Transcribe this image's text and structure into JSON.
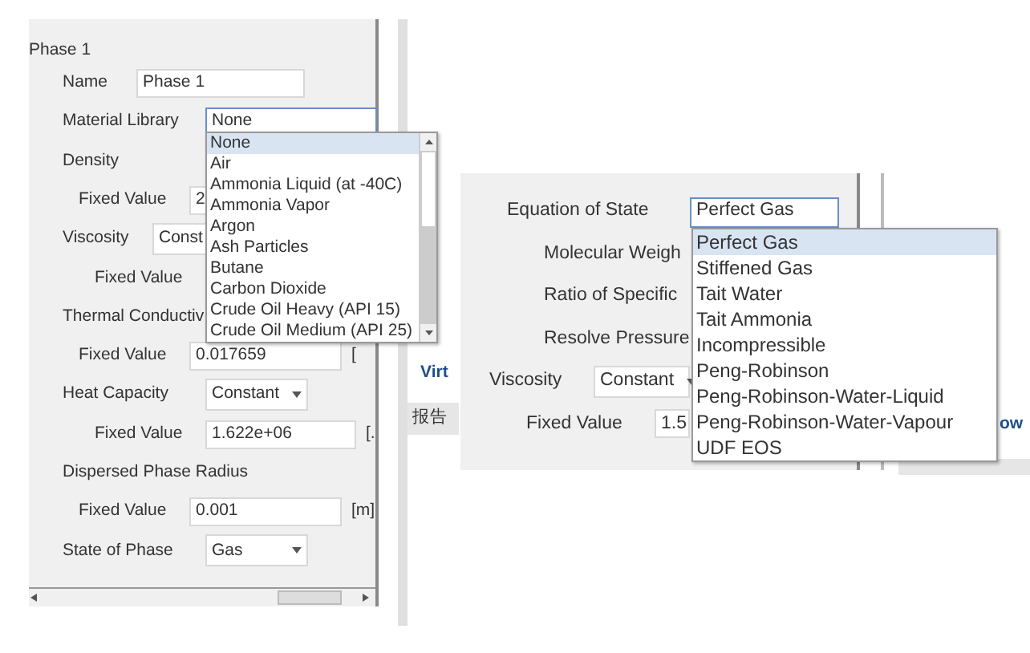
{
  "phase_panel": {
    "title": "Phase 1",
    "fields": [
      {
        "kind": "input",
        "label": "Name",
        "value": "Phase 1"
      },
      {
        "kind": "select-open",
        "label": "Material Library",
        "value": "None"
      },
      {
        "kind": "heading",
        "label": "Density",
        "children": [
          {
            "kind": "input",
            "label": "Fixed Value",
            "value": "2"
          }
        ]
      },
      {
        "kind": "select",
        "label": "Viscosity",
        "value": "Const",
        "children": [
          {
            "kind": "heading",
            "label": "Fixed Value"
          }
        ]
      },
      {
        "kind": "heading",
        "label": "Thermal Conductiv",
        "children": [
          {
            "kind": "input",
            "label": "Fixed Value",
            "value": "0.017659",
            "unit": "["
          }
        ]
      },
      {
        "kind": "select",
        "label": "Heat Capacity",
        "value": "Constant",
        "children": [
          {
            "kind": "input",
            "label": "Fixed Value",
            "value": "1.622e+06",
            "unit": "[."
          }
        ]
      },
      {
        "kind": "heading",
        "label": "Dispersed Phase Radius",
        "children": [
          {
            "kind": "input",
            "label": "Fixed Value",
            "value": "0.001",
            "unit": "[m]"
          }
        ]
      },
      {
        "kind": "select",
        "label": "State of Phase",
        "value": "Gas"
      }
    ],
    "material_options": [
      {
        "label": "None",
        "selected": true
      },
      {
        "label": "Air",
        "selected": false
      },
      {
        "label": "Ammonia Liquid (at -40C)",
        "selected": false
      },
      {
        "label": "Ammonia Vapor",
        "selected": false
      },
      {
        "label": "Argon",
        "selected": false
      },
      {
        "label": "Ash Particles",
        "selected": false
      },
      {
        "label": "Butane",
        "selected": false
      },
      {
        "label": "Carbon Dioxide",
        "selected": false
      },
      {
        "label": "Crude Oil Heavy (API 15)",
        "selected": false
      },
      {
        "label": "Crude Oil Medium (API 25)",
        "selected": false
      }
    ]
  },
  "background_window": {
    "link": "Virt",
    "tab": "报告",
    "right_link": "ow"
  },
  "eos_panel": {
    "fields": [
      {
        "kind": "select-open",
        "label": "Equation of State",
        "value": "Perfect Gas"
      },
      {
        "kind": "heading",
        "label": "Molecular Weigh"
      },
      {
        "kind": "heading",
        "label": "Ratio of Specific"
      },
      {
        "kind": "heading",
        "label": "Resolve Pressure"
      },
      {
        "kind": "select",
        "label": "Viscosity",
        "value": "Constant"
      },
      {
        "kind": "input",
        "label": "Fixed Value",
        "value": "1.5"
      }
    ],
    "eos_options": [
      {
        "label": "Perfect Gas",
        "selected": true
      },
      {
        "label": "Stiffened Gas",
        "selected": false
      },
      {
        "label": "Tait Water",
        "selected": false
      },
      {
        "label": "Tait Ammonia",
        "selected": false
      },
      {
        "label": "Incompressible",
        "selected": false
      },
      {
        "label": "Peng-Robinson",
        "selected": false
      },
      {
        "label": "Peng-Robinson-Water-Liquid",
        "selected": false
      },
      {
        "label": "Peng-Robinson-Water-Vapour",
        "selected": false
      },
      {
        "label": "UDF EOS",
        "selected": false
      }
    ]
  }
}
